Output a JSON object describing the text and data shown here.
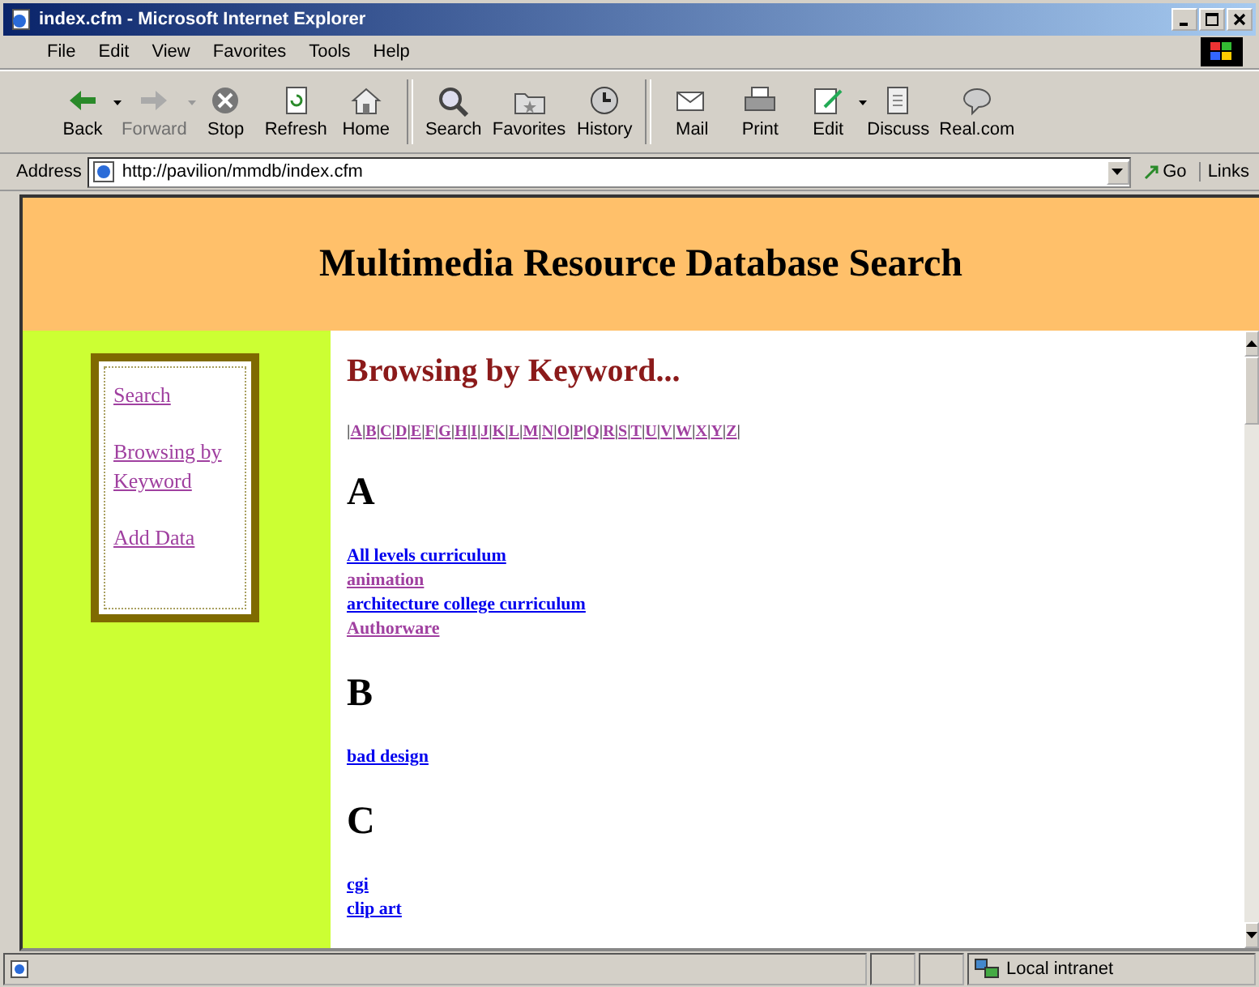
{
  "window": {
    "title": "index.cfm - Microsoft Internet Explorer"
  },
  "menu": [
    "File",
    "Edit",
    "View",
    "Favorites",
    "Tools",
    "Help"
  ],
  "toolbar": [
    {
      "kind": "back",
      "label": "Back",
      "disabled": false,
      "dropdown": true
    },
    {
      "kind": "forward",
      "label": "Forward",
      "disabled": true,
      "dropdown": true
    },
    {
      "kind": "stop",
      "label": "Stop",
      "disabled": false,
      "dropdown": false
    },
    {
      "kind": "refresh",
      "label": "Refresh",
      "disabled": false,
      "dropdown": false
    },
    {
      "kind": "home",
      "label": "Home",
      "disabled": false,
      "dropdown": false
    },
    {
      "kind": "search",
      "label": "Search",
      "disabled": false,
      "dropdown": false
    },
    {
      "kind": "favorites",
      "label": "Favorites",
      "disabled": false,
      "dropdown": false
    },
    {
      "kind": "history",
      "label": "History",
      "disabled": false,
      "dropdown": false
    },
    {
      "kind": "mail",
      "label": "Mail",
      "disabled": false,
      "dropdown": false
    },
    {
      "kind": "print",
      "label": "Print",
      "disabled": false,
      "dropdown": false
    },
    {
      "kind": "edit",
      "label": "Edit",
      "disabled": false,
      "dropdown": true
    },
    {
      "kind": "discuss",
      "label": "Discuss",
      "disabled": false,
      "dropdown": false
    },
    {
      "kind": "real",
      "label": "Real.com",
      "disabled": false,
      "dropdown": false
    }
  ],
  "address_bar": {
    "label": "Address",
    "value": "http://pavilion/mmdb/index.cfm",
    "go": "Go",
    "links": "Links"
  },
  "page": {
    "banner": "Multimedia Resource Database Search",
    "nav": [
      {
        "label": "Search",
        "visited": true
      },
      {
        "label": "Browsing by Keyword",
        "visited": true
      },
      {
        "label": "Add Data",
        "visited": true
      }
    ],
    "heading": "Browsing by Keyword...",
    "letters": [
      {
        "bar": "|",
        "label": "A"
      },
      {
        "bar": "|",
        "label": "B"
      },
      {
        "bar": "|",
        "label": "C"
      },
      {
        "bar": "|",
        "label": "D"
      },
      {
        "bar": "|",
        "label": "E"
      },
      {
        "bar": "|",
        "label": "F"
      },
      {
        "bar": "|",
        "label": "G"
      },
      {
        "bar": "|",
        "label": "H"
      },
      {
        "bar": "|",
        "label": "I"
      },
      {
        "bar": "|",
        "label": "J"
      },
      {
        "bar": "|",
        "label": "K"
      },
      {
        "bar": "|",
        "label": "L"
      },
      {
        "bar": "|",
        "label": "M"
      },
      {
        "bar": "|",
        "label": "N"
      },
      {
        "bar": "|",
        "label": "O"
      },
      {
        "bar": "|",
        "label": "P"
      },
      {
        "bar": "|",
        "label": "Q"
      },
      {
        "bar": "|",
        "label": "R"
      },
      {
        "bar": "|",
        "label": "S"
      },
      {
        "bar": "|",
        "label": "T"
      },
      {
        "bar": "|",
        "label": "U"
      },
      {
        "bar": "|",
        "label": "V"
      },
      {
        "bar": "|",
        "label": "W"
      },
      {
        "bar": "|",
        "label": "X"
      },
      {
        "bar": "|",
        "label": "Y"
      },
      {
        "bar": "|",
        "label": "Z"
      }
    ],
    "letters_end": "|",
    "sections": [
      {
        "letter": "A",
        "keywords": [
          {
            "label": "All levels curriculum",
            "visited": false
          },
          {
            "label": "animation",
            "visited": true
          },
          {
            "label": "architecture college curriculum",
            "visited": false
          },
          {
            "label": "Authorware",
            "visited": true
          }
        ]
      },
      {
        "letter": "B",
        "keywords": [
          {
            "label": "bad design",
            "visited": false
          }
        ]
      },
      {
        "letter": "C",
        "keywords": [
          {
            "label": "cgi",
            "visited": false
          },
          {
            "label": "clip art",
            "visited": false
          }
        ]
      }
    ]
  },
  "status_bar": {
    "zone": "Local intranet"
  }
}
